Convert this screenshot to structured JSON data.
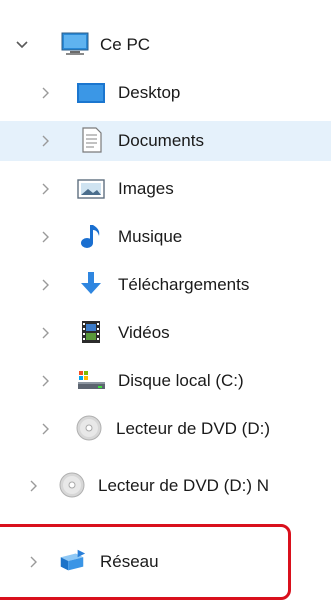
{
  "tree": {
    "root": {
      "label": "Ce PC",
      "icon": "monitor-icon",
      "expanded": true
    },
    "children": [
      {
        "label": "Desktop",
        "icon": "desktop-folder-icon"
      },
      {
        "label": "Documents",
        "icon": "documents-icon"
      },
      {
        "label": "Images",
        "icon": "images-icon"
      },
      {
        "label": "Musique",
        "icon": "music-icon"
      },
      {
        "label": "Téléchargements",
        "icon": "downloads-icon"
      },
      {
        "label": "Vidéos",
        "icon": "videos-icon"
      },
      {
        "label": "Disque local (C:)",
        "icon": "local-disk-icon"
      },
      {
        "label": "Lecteur de DVD (D:)",
        "icon": "dvd-drive-icon"
      }
    ],
    "dvd_drive_top": {
      "label": "Lecteur de DVD (D:) N",
      "icon": "dvd-drive-icon"
    },
    "network": {
      "label": "Réseau",
      "icon": "network-icon"
    }
  },
  "colors": {
    "selected_row": "#e5f1fb",
    "highlight_outline": "#d9101c"
  }
}
